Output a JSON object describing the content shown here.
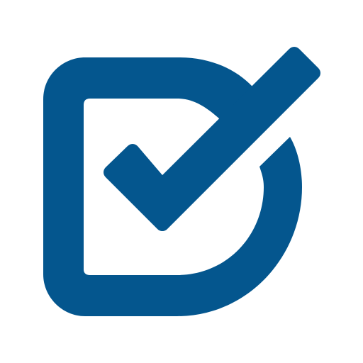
{
  "logo": {
    "name": "checkbox-check-icon",
    "color": "#04568e",
    "background": "#ffffff"
  }
}
